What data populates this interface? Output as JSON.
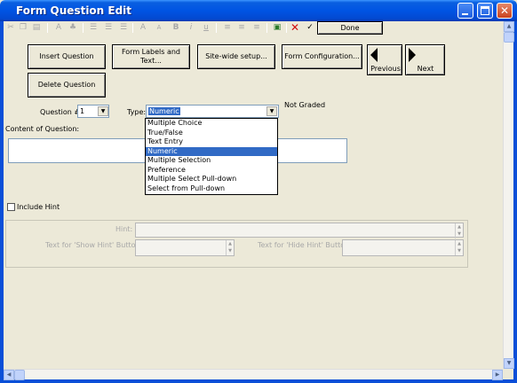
{
  "window": {
    "title": "Form Question Edit"
  },
  "toolbar": {
    "done_label": "Done",
    "font_increase": "A",
    "font_decrease": "A",
    "bold": "B",
    "italic": "i",
    "underline": "u"
  },
  "buttons": {
    "insert_question": "Insert Question",
    "form_labels": "Form Labels and Text...",
    "site_wide_setup": "Site-wide setup...",
    "form_configuration": "Form Configuration...",
    "previous": "Previous",
    "next": "Next",
    "delete_question": "Delete Question"
  },
  "question": {
    "number_label": "Question #",
    "number_value": "1",
    "type_label": "Type:",
    "type_value": "Numeric",
    "grading_status": "Not Graded",
    "content_label": "Content of Question:",
    "type_options": [
      "Multiple Choice",
      "True/False",
      "Text Entry",
      "Numeric",
      "Multiple Selection",
      "Preference",
      "Multiple Select Pull-down",
      "Select from Pull-down"
    ],
    "selected_index": 3
  },
  "hint": {
    "include_label": "Include Hint",
    "include_checked": false,
    "hint_label": "Hint:",
    "show_hint_label": "Text for 'Show Hint' Button:",
    "hide_hint_label": "Text for 'Hide Hint' Button:"
  }
}
